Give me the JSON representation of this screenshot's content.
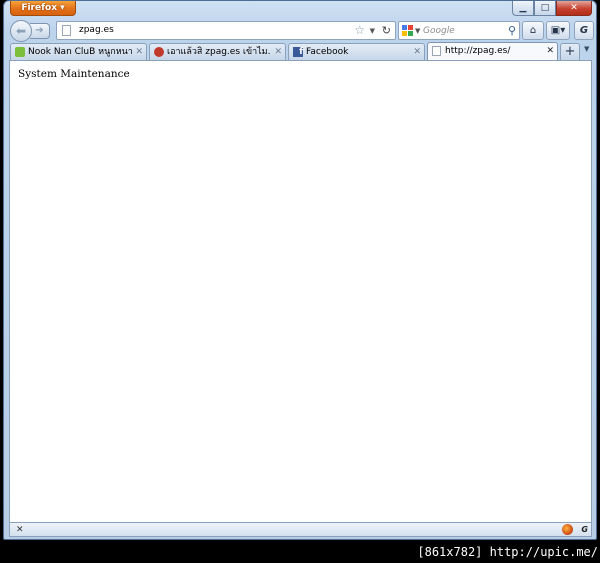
{
  "window": {
    "app_button_label": "Firefox",
    "controls": {
      "minimize": "▁",
      "maximize": "□",
      "close": "✕"
    }
  },
  "navbar": {
    "back_icon": "back-arrow-icon",
    "forward_icon": "forward-arrow-icon",
    "url": "zpag.es",
    "search": {
      "placeholder": "Google"
    },
    "buttons": {
      "home": "⌂",
      "addon": "▣▾",
      "gm": "G"
    }
  },
  "tabs": [
    {
      "label": "Nook Nan CluB หนูกหนาน...",
      "icon_color": "#7cbf3a",
      "active": false
    },
    {
      "label": "เอาแล้วสิ zpag.es เข้าไม...",
      "icon_color": "#c0392b",
      "active": false
    },
    {
      "label": "Facebook",
      "icon_color": "#3b5998",
      "active": false
    },
    {
      "label": "http://zpag.es/",
      "icon_color": "#ffffff",
      "active": true
    }
  ],
  "tab_close_glyph": "✕",
  "newtab_label": "+",
  "page": {
    "body_text": "System Maintenance"
  },
  "addon_bar": {
    "close_glyph": "✕"
  },
  "caption": "[861x782] http://upic.me/"
}
